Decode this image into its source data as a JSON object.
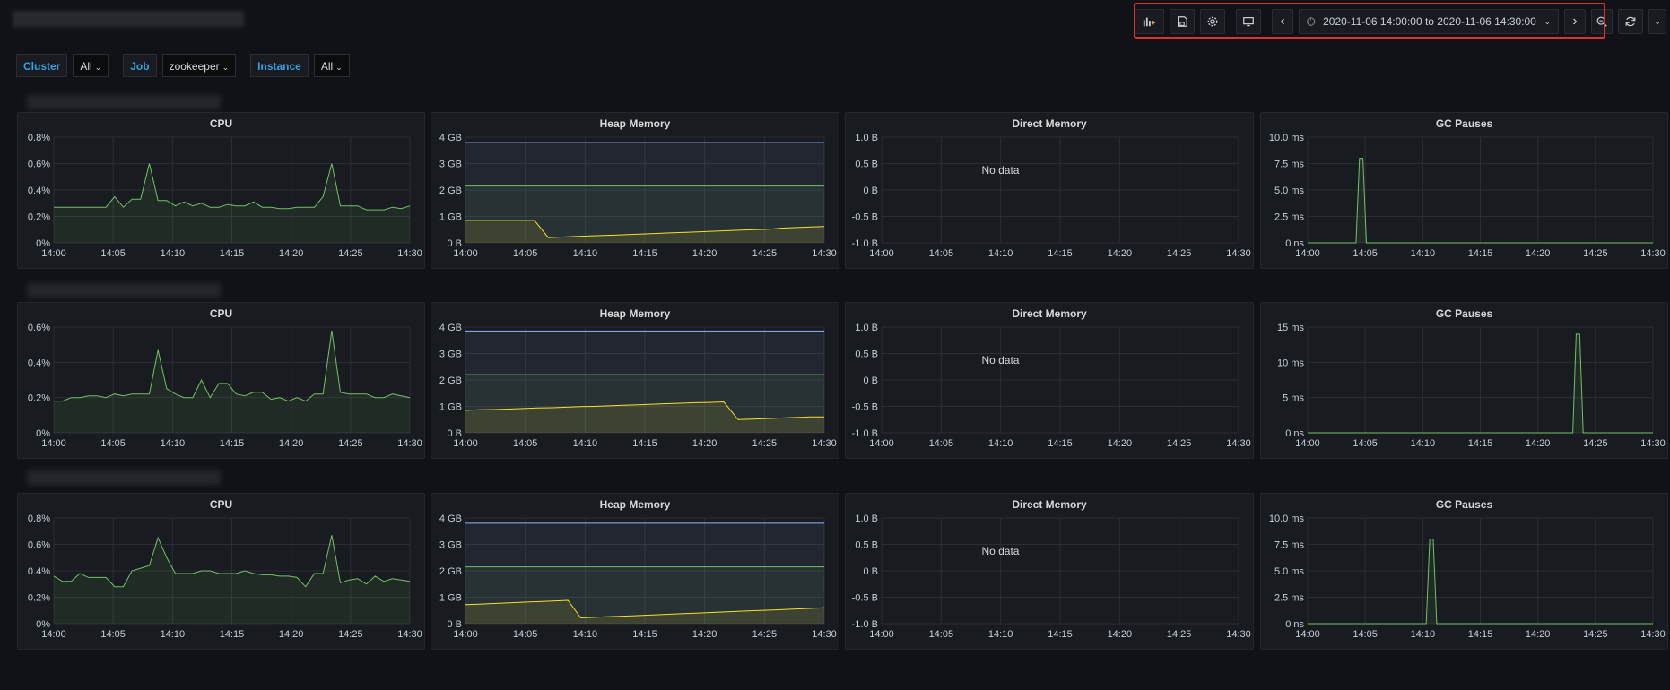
{
  "toolbar": {
    "add_panel_icon": "add-panel-icon",
    "save_icon": "save-icon",
    "settings_icon": "gear-icon",
    "tv_icon": "monitor-icon",
    "time_range": "2020-11-06 14:00:00 to 2020-11-06 14:30:00",
    "prev_icon": "chevron-left-icon",
    "next_icon": "chevron-right-icon",
    "zoom_icon": "zoom-out-icon",
    "refresh_icon": "refresh-icon",
    "refresh_menu_icon": "chevron-down-icon"
  },
  "variables": [
    {
      "label": "Cluster",
      "value": "All"
    },
    {
      "label": "Job",
      "value": "zookeeper"
    },
    {
      "label": "Instance",
      "value": "All"
    }
  ],
  "colors": {
    "green": "#73bf69",
    "yellow": "#fade2a",
    "blue": "#8ab8ff",
    "highlight": "#e02f2f",
    "var_label": "#33a2e5"
  },
  "x_ticks": [
    "14:00",
    "14:05",
    "14:10",
    "14:15",
    "14:20",
    "14:25",
    "14:30"
  ],
  "no_data": "No data",
  "rows": [
    {
      "cpu": {
        "title": "CPU",
        "y_ticks": [
          "0.8%",
          "0.6%",
          "0.4%",
          "0.2%",
          "0%"
        ],
        "ymax": 0.8,
        "values": [
          0.27,
          0.27,
          0.27,
          0.27,
          0.27,
          0.27,
          0.27,
          0.35,
          0.27,
          0.33,
          0.33,
          0.6,
          0.32,
          0.32,
          0.28,
          0.31,
          0.28,
          0.3,
          0.27,
          0.27,
          0.29,
          0.28,
          0.28,
          0.31,
          0.27,
          0.27,
          0.26,
          0.26,
          0.27,
          0.27,
          0.27,
          0.35,
          0.6,
          0.28,
          0.28,
          0.28,
          0.25,
          0.25,
          0.25,
          0.27,
          0.26,
          0.28
        ]
      },
      "heap": {
        "title": "Heap Memory",
        "y_ticks": [
          "4 GB",
          "3 GB",
          "2 GB",
          "1 GB",
          "0 B"
        ],
        "ymax": 4,
        "limit": 3.8,
        "committed": 2.15,
        "values": [
          0.85,
          0.85,
          0.85,
          0.85,
          0.85,
          0.85,
          0.2,
          0.22,
          0.24,
          0.26,
          0.28,
          0.3,
          0.32,
          0.34,
          0.36,
          0.38,
          0.4,
          0.42,
          0.44,
          0.46,
          0.48,
          0.5,
          0.52,
          0.56,
          0.58,
          0.6,
          0.62
        ]
      },
      "direct": {
        "title": "Direct Memory",
        "y_ticks": [
          "1.0 B",
          "0.5 B",
          "0 B",
          "-0.5 B",
          "-1.0 B"
        ]
      },
      "gc": {
        "title": "GC Pauses",
        "y_ticks": [
          "10.0 ms",
          "7.5 ms",
          "5.0 ms",
          "2.5 ms",
          "0 ns"
        ],
        "ymax": 10,
        "values": [
          0,
          0,
          0,
          0,
          0,
          0,
          0,
          0,
          0,
          0,
          0,
          0,
          0,
          0,
          0,
          8,
          8,
          0,
          0,
          0,
          0,
          0,
          0,
          0,
          0,
          0,
          0,
          0,
          0,
          0,
          0,
          0,
          0,
          0,
          0,
          0,
          0,
          0,
          0,
          0,
          0,
          0,
          0,
          0,
          0,
          0,
          0,
          0,
          0,
          0,
          0,
          0,
          0,
          0,
          0,
          0,
          0,
          0,
          0,
          0,
          0,
          0,
          0,
          0,
          0,
          0,
          0,
          0,
          0,
          0,
          0,
          0,
          0,
          0,
          0,
          0,
          0,
          0,
          0,
          0,
          0,
          0,
          0,
          0,
          0,
          0,
          0,
          0,
          0,
          0,
          0,
          0,
          0,
          0,
          0,
          0,
          0,
          0,
          0,
          0,
          0
        ]
      }
    },
    {
      "cpu": {
        "title": "CPU",
        "y_ticks": [
          "0.6%",
          "0.4%",
          "0.2%",
          "0%"
        ],
        "ymax": 0.6,
        "values": [
          0.18,
          0.18,
          0.2,
          0.2,
          0.21,
          0.21,
          0.2,
          0.22,
          0.21,
          0.22,
          0.22,
          0.22,
          0.47,
          0.25,
          0.22,
          0.2,
          0.2,
          0.3,
          0.2,
          0.28,
          0.28,
          0.22,
          0.21,
          0.23,
          0.23,
          0.19,
          0.2,
          0.18,
          0.2,
          0.18,
          0.22,
          0.22,
          0.58,
          0.23,
          0.22,
          0.22,
          0.22,
          0.2,
          0.2,
          0.22,
          0.21,
          0.2
        ]
      },
      "heap": {
        "title": "Heap Memory",
        "y_ticks": [
          "4 GB",
          "3 GB",
          "2 GB",
          "1 GB",
          "0 B"
        ],
        "ymax": 4,
        "limit": 3.85,
        "committed": 2.2,
        "values": [
          0.85,
          0.87,
          0.88,
          0.9,
          0.92,
          0.94,
          0.95,
          0.97,
          0.99,
          1.0,
          1.02,
          1.04,
          1.06,
          1.08,
          1.1,
          1.12,
          1.14,
          1.15,
          1.17,
          0.5,
          0.52,
          0.54,
          0.56,
          0.58,
          0.6,
          0.6
        ]
      },
      "direct": {
        "title": "Direct Memory",
        "y_ticks": [
          "1.0 B",
          "0.5 B",
          "0 B",
          "-0.5 B",
          "-1.0 B"
        ]
      },
      "gc": {
        "title": "GC Pauses",
        "y_ticks": [
          "15 ms",
          "10 ms",
          "5 ms",
          "0 ns"
        ],
        "ymax": 15,
        "values": [
          0,
          0,
          0,
          0,
          0,
          0,
          0,
          0,
          0,
          0,
          0,
          0,
          0,
          0,
          0,
          0,
          0,
          0,
          0,
          0,
          0,
          0,
          0,
          0,
          0,
          0,
          0,
          0,
          0,
          0,
          0,
          0,
          0,
          0,
          0,
          0,
          0,
          0,
          0,
          0,
          0,
          0,
          0,
          0,
          0,
          0,
          0,
          0,
          0,
          0,
          0,
          0,
          0,
          0,
          0,
          0,
          0,
          0,
          0,
          0,
          0,
          0,
          0,
          0,
          0,
          0,
          0,
          0,
          0,
          0,
          0,
          0,
          0,
          0,
          0,
          0,
          0,
          14,
          14,
          0,
          0,
          0,
          0,
          0,
          0,
          0,
          0,
          0,
          0,
          0,
          0,
          0,
          0,
          0,
          0,
          0,
          0,
          0,
          0,
          0
        ]
      }
    },
    {
      "cpu": {
        "title": "CPU",
        "y_ticks": [
          "0.8%",
          "0.6%",
          "0.4%",
          "0.2%",
          "0%"
        ],
        "ymax": 0.8,
        "values": [
          0.36,
          0.32,
          0.32,
          0.38,
          0.35,
          0.35,
          0.35,
          0.28,
          0.28,
          0.4,
          0.42,
          0.44,
          0.65,
          0.5,
          0.38,
          0.38,
          0.38,
          0.4,
          0.4,
          0.38,
          0.38,
          0.38,
          0.4,
          0.38,
          0.37,
          0.37,
          0.36,
          0.36,
          0.35,
          0.28,
          0.38,
          0.38,
          0.67,
          0.31,
          0.33,
          0.34,
          0.3,
          0.36,
          0.32,
          0.34,
          0.33,
          0.32
        ]
      },
      "heap": {
        "title": "Heap Memory",
        "y_ticks": [
          "4 GB",
          "3 GB",
          "2 GB",
          "1 GB",
          "0 B"
        ],
        "ymax": 4,
        "limit": 3.8,
        "committed": 2.15,
        "values": [
          0.72,
          0.74,
          0.76,
          0.78,
          0.8,
          0.82,
          0.84,
          0.86,
          0.88,
          0.22,
          0.24,
          0.26,
          0.28,
          0.3,
          0.32,
          0.34,
          0.36,
          0.38,
          0.4,
          0.42,
          0.44,
          0.46,
          0.48,
          0.5,
          0.52,
          0.54,
          0.56,
          0.58,
          0.6
        ]
      },
      "direct": {
        "title": "Direct Memory",
        "y_ticks": [
          "1.0 B",
          "0.5 B",
          "0 B",
          "-0.5 B",
          "-1.0 B"
        ]
      },
      "gc": {
        "title": "GC Pauses",
        "y_ticks": [
          "10.0 ms",
          "7.5 ms",
          "5.0 ms",
          "2.5 ms",
          "0 ns"
        ],
        "ymax": 10,
        "values": [
          0,
          0,
          0,
          0,
          0,
          0,
          0,
          0,
          0,
          0,
          0,
          0,
          0,
          0,
          0,
          0,
          0,
          0,
          0,
          0,
          0,
          0,
          0,
          0,
          0,
          0,
          0,
          0,
          0,
          0,
          0,
          0,
          0,
          0,
          0,
          8,
          8,
          0,
          0,
          0,
          0,
          0,
          0,
          0,
          0,
          0,
          0,
          0,
          0,
          0,
          0,
          0,
          0,
          0,
          0,
          0,
          0,
          0,
          0,
          0,
          0,
          0,
          0,
          0,
          0,
          0,
          0,
          0,
          0,
          0,
          0,
          0,
          0,
          0,
          0,
          0,
          0,
          0,
          0,
          0,
          0,
          0,
          0,
          0,
          0,
          0,
          0,
          0,
          0,
          0,
          0,
          0,
          0,
          0,
          0,
          0,
          0,
          0,
          0,
          0
        ]
      }
    }
  ]
}
